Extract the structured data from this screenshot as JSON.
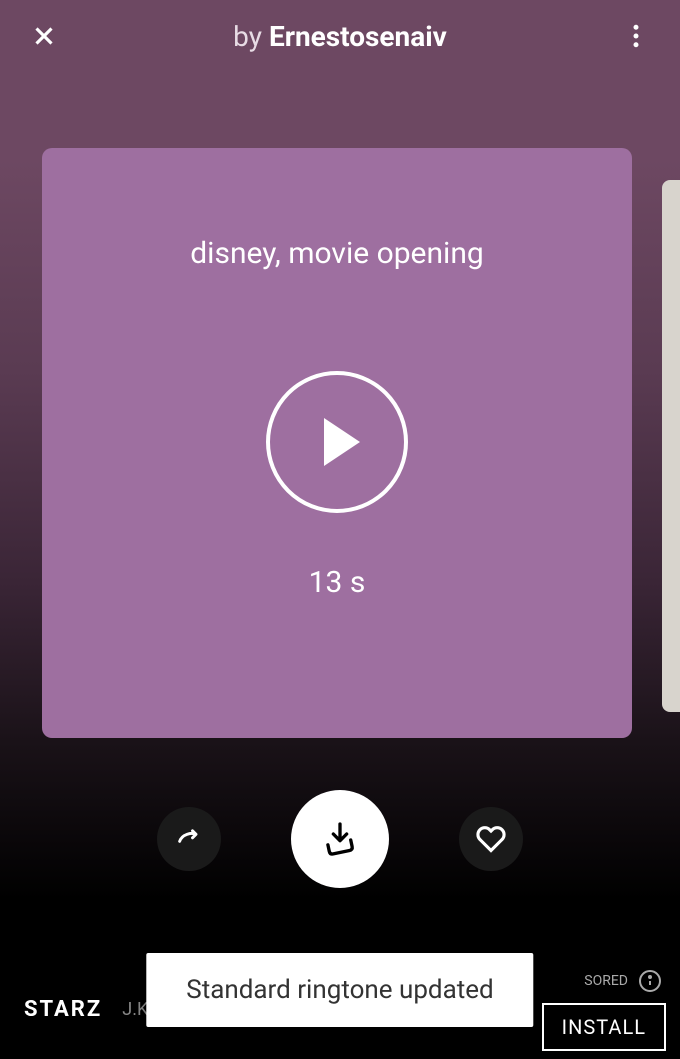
{
  "header": {
    "by_label": "by ",
    "author": "Ernestosenaiv"
  },
  "ringtone": {
    "title": "disney, movie opening",
    "duration": "13 s"
  },
  "toast": {
    "message": "Standard ringtone updated"
  },
  "ad": {
    "logo": "STARZ",
    "text": "J.K. Simmons in @Counterpart",
    "sponsored": "SORED",
    "install": "INSTALL"
  },
  "icons": {
    "close": "close",
    "more": "more-vertical",
    "play": "play",
    "share": "share",
    "download": "download",
    "heart": "heart",
    "info": "info"
  }
}
